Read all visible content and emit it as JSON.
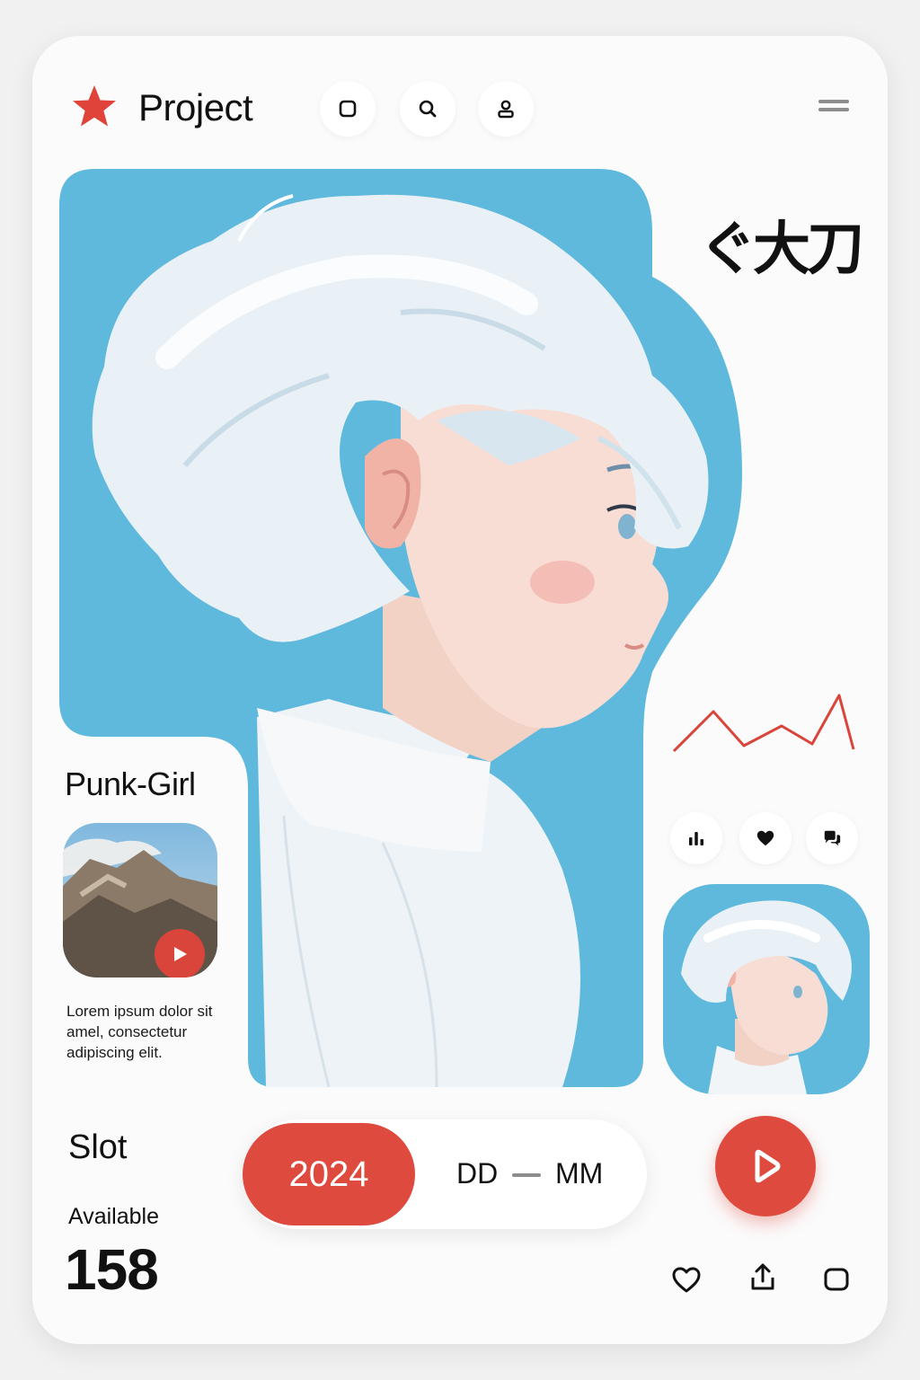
{
  "header": {
    "brand": "Project",
    "top_buttons": [
      {
        "name": "square-button",
        "icon": "square-icon"
      },
      {
        "name": "search-button",
        "icon": "search-icon"
      },
      {
        "name": "profile-button",
        "icon": "user-icon"
      }
    ],
    "menu_icon": "hamburger-icon"
  },
  "hero": {
    "overlay_text": "ぐ大刀",
    "illustration": "white-haired girl profile",
    "colors": {
      "background": "#5fb9dc",
      "accent": "#de4a3e"
    }
  },
  "stats_buttons": [
    {
      "name": "stats-button",
      "icon": "bar-chart-icon"
    },
    {
      "name": "like-button",
      "icon": "heart-icon"
    },
    {
      "name": "chat-button",
      "icon": "chat-icon"
    }
  ],
  "feature": {
    "title": "Punk-Girl",
    "description": "Lorem ipsum dolor sit amel, consectetur adipiscing elit."
  },
  "slot": {
    "label": "Slot",
    "available_label": "Available",
    "available_count": "158"
  },
  "date": {
    "year": "2024",
    "day_placeholder": "DD",
    "month_placeholder": "MM"
  },
  "footer_icons": [
    "heart-icon",
    "share-icon",
    "square-icon"
  ]
}
